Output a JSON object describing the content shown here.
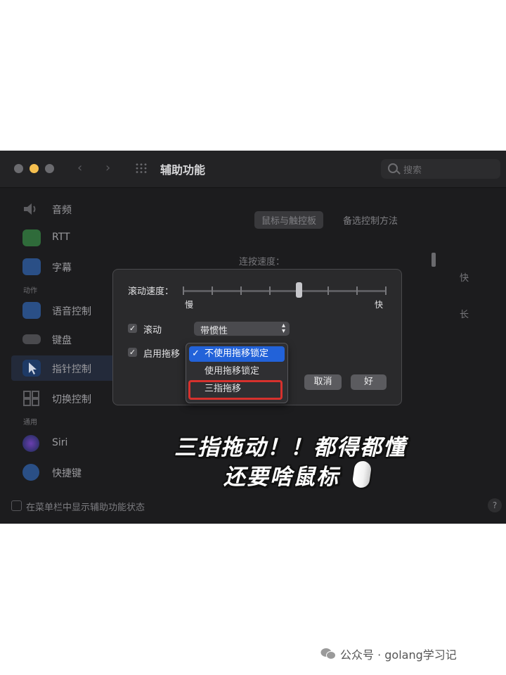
{
  "window": {
    "title": "辅助功能",
    "search_placeholder": "搜索"
  },
  "sidebar": {
    "items": [
      {
        "label": "音频",
        "icon": "speaker-icon"
      },
      {
        "label": "RTT",
        "icon": "rtt-icon"
      },
      {
        "label": "字幕",
        "icon": "captions-icon"
      },
      {
        "label": "语音控制",
        "icon": "voice-control-icon"
      },
      {
        "label": "键盘",
        "icon": "keyboard-icon"
      },
      {
        "label": "指针控制",
        "icon": "pointer-icon"
      },
      {
        "label": "切换控制",
        "icon": "switch-control-icon"
      },
      {
        "label": "Siri",
        "icon": "siri-icon"
      },
      {
        "label": "快捷键",
        "icon": "shortcut-icon"
      }
    ],
    "section_motion": "动作",
    "section_general": "通用"
  },
  "footer": {
    "show_status_label": "在菜单栏中显示辅助功能状态",
    "help": "?"
  },
  "main": {
    "tabs": [
      "鼠标与触控板",
      "备选控制方法"
    ],
    "double_click_label": "连按速度：",
    "bg_fast": "快",
    "bg_long": "长"
  },
  "sheet": {
    "scroll_speed_label": "滚动速度：",
    "slow": "慢",
    "fast": "快",
    "scroll_speed_value": 0.57,
    "scroll_label": "滚动",
    "scroll_checked": true,
    "scroll_popup_value": "带惯性",
    "drag_label": "启用拖移",
    "drag_checked": true,
    "cancel": "取消",
    "ok": "好"
  },
  "drag_menu": {
    "items": [
      "不使用拖移锁定",
      "使用拖移锁定",
      "三指拖移"
    ],
    "selected_check": "✓",
    "highlighted_index": 0,
    "boxed_index": 2
  },
  "caption": {
    "line1": "三指拖动！！都得都懂",
    "line2": "还要啥鼠标"
  },
  "watermark": "公众号 · golang学习记",
  "colors": {
    "accent": "#2262d9",
    "highlight_box": "#d6312d"
  }
}
